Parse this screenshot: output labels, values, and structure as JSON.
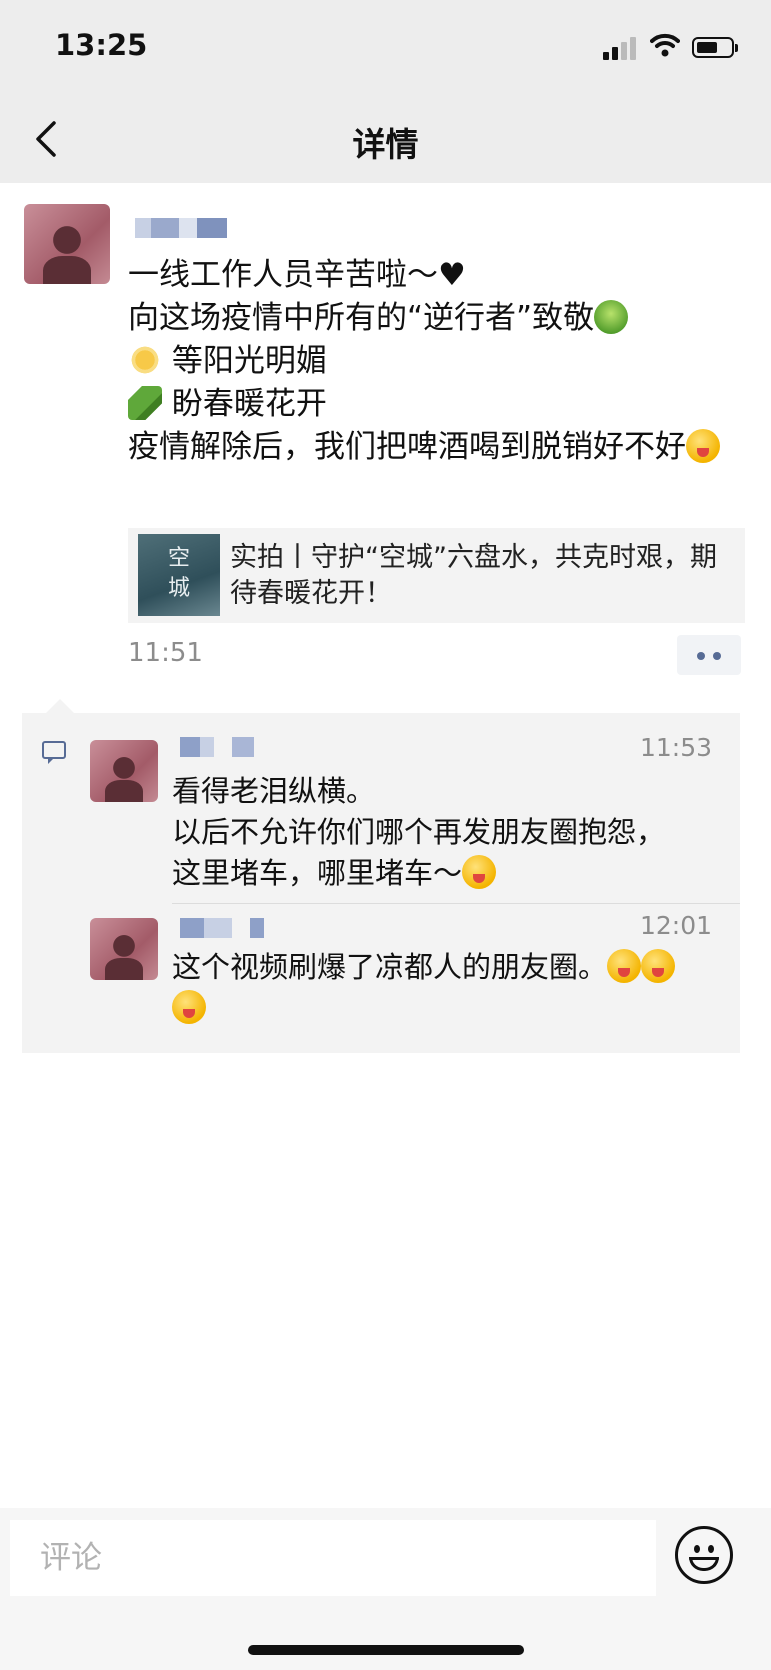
{
  "status_bar": {
    "time": "13:25"
  },
  "nav": {
    "title": "详情"
  },
  "post": {
    "lines": [
      "一线工作人员辛苦啦～",
      "向这场疫情中所有的“逆行者”致敬",
      "等阳光明媚",
      "盼春暖花开",
      "疫情解除后，我们把啤酒喝到脱销好不好"
    ],
    "heart": "♥",
    "link": {
      "thumb_text": "空城",
      "title": "实拍丨守护“空城”六盘水，共克时艰，期待春暖花开！"
    },
    "time": "11:51"
  },
  "comments": [
    {
      "time": "11:53",
      "lines": [
        "看得老泪纵横。",
        "以后不允许你们哪个再发朋友圈抱怨，",
        "这里堵车，哪里堵车～"
      ]
    },
    {
      "time": "12:01",
      "lines": [
        "这个视频刷爆了凉都人的朋友圈。"
      ]
    }
  ],
  "input": {
    "placeholder": "评论"
  },
  "colors": {
    "link_blue": "#576b95",
    "header_bg": "#ededed",
    "card_bg": "#f3f3f3"
  }
}
